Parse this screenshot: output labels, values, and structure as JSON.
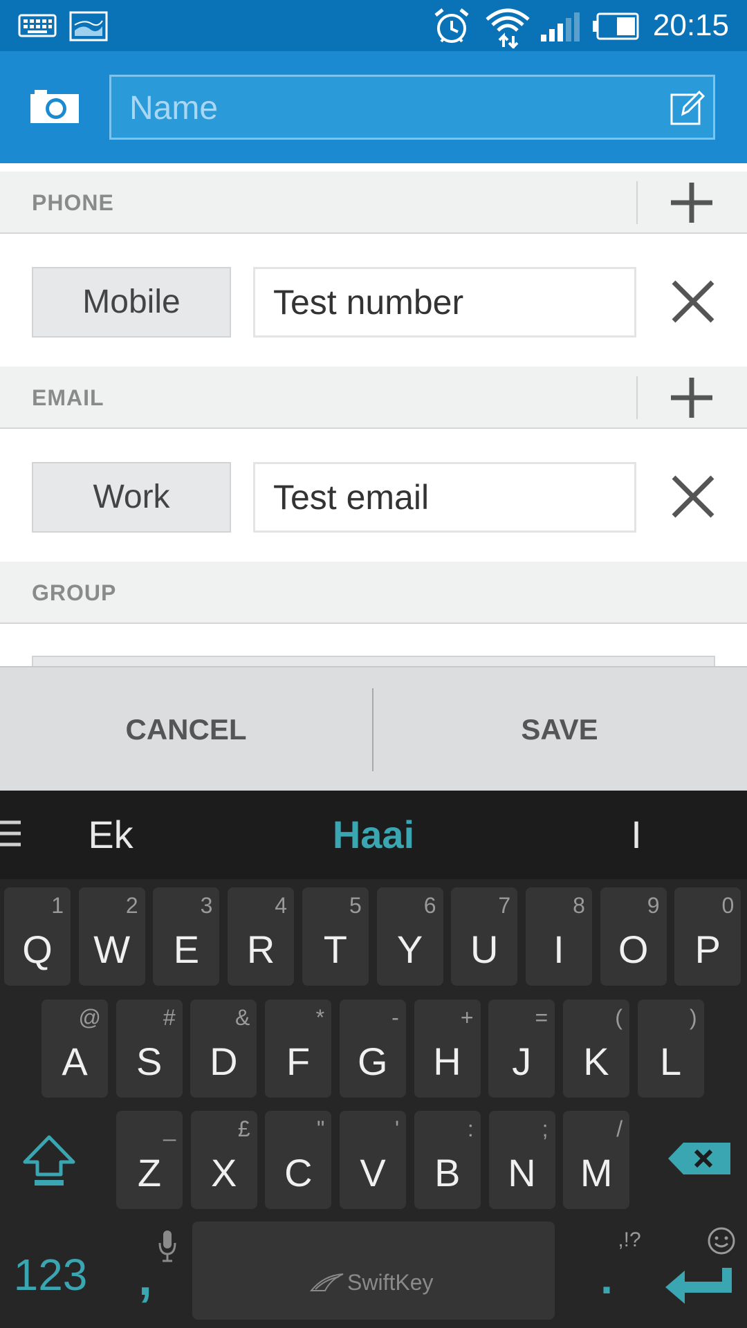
{
  "status_bar": {
    "time": "20:15"
  },
  "header": {
    "name_placeholder": "Name"
  },
  "phone": {
    "section_label": "PHONE",
    "type": "Mobile",
    "value": "Test number"
  },
  "email": {
    "section_label": "EMAIL",
    "type": "Work",
    "value": "Test email"
  },
  "group": {
    "section_label": "GROUP"
  },
  "actions": {
    "cancel": "CANCEL",
    "save": "SAVE"
  },
  "keyboard": {
    "suggestions": [
      "Ek",
      "Haai",
      "I"
    ],
    "row1": [
      {
        "key": "Q",
        "sub": "1"
      },
      {
        "key": "W",
        "sub": "2"
      },
      {
        "key": "E",
        "sub": "3"
      },
      {
        "key": "R",
        "sub": "4"
      },
      {
        "key": "T",
        "sub": "5"
      },
      {
        "key": "Y",
        "sub": "6"
      },
      {
        "key": "U",
        "sub": "7"
      },
      {
        "key": "I",
        "sub": "8"
      },
      {
        "key": "O",
        "sub": "9"
      },
      {
        "key": "P",
        "sub": "0"
      }
    ],
    "row2": [
      {
        "key": "A",
        "sub": "@"
      },
      {
        "key": "S",
        "sub": "#"
      },
      {
        "key": "D",
        "sub": "&"
      },
      {
        "key": "F",
        "sub": "*"
      },
      {
        "key": "G",
        "sub": "-"
      },
      {
        "key": "H",
        "sub": "+"
      },
      {
        "key": "J",
        "sub": "="
      },
      {
        "key": "K",
        "sub": "("
      },
      {
        "key": "L",
        "sub": ")"
      }
    ],
    "row3": [
      {
        "key": "Z",
        "sub": "_"
      },
      {
        "key": "X",
        "sub": "£"
      },
      {
        "key": "C",
        "sub": "\""
      },
      {
        "key": "V",
        "sub": "'"
      },
      {
        "key": "B",
        "sub": ":"
      },
      {
        "key": "N",
        "sub": ";"
      },
      {
        "key": "M",
        "sub": "/"
      }
    ],
    "numbers_key": "123",
    "comma_key": ",",
    "space_brand": "SwiftKey",
    "period_key": ".",
    "punct_hint": ",!?"
  },
  "colors": {
    "status_bar": "#0a73b8",
    "header": "#1b8ad1",
    "accent": "#3aa6b2",
    "keyboard_bg": "#262626"
  }
}
